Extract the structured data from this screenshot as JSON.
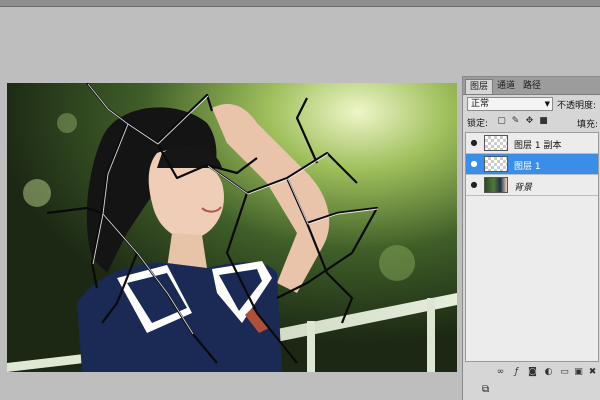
{
  "panel": {
    "tabs": [
      "图层",
      "通道",
      "路径"
    ],
    "blend_mode": "正常",
    "opacity_label": "不透明度:",
    "lock_label": "锁定:",
    "fill_label": "填充:",
    "layers": [
      {
        "name": "图层 1 副本",
        "selected": false,
        "visible": true,
        "thumb": "transparent"
      },
      {
        "name": "图层 1",
        "selected": true,
        "visible": true,
        "thumb": "transparent"
      },
      {
        "name": "背景",
        "selected": false,
        "visible": true,
        "thumb": "photo",
        "italic": true
      }
    ],
    "bottom_icons": [
      "link-icon",
      "fx-icon",
      "mask-icon",
      "adjustment-icon",
      "folder-icon",
      "new-layer-icon",
      "trash-icon"
    ]
  },
  "colors": {
    "selection": "#3a8ee8",
    "panel_bg": "#d6d6d6",
    "workspace": "#bebebe"
  }
}
